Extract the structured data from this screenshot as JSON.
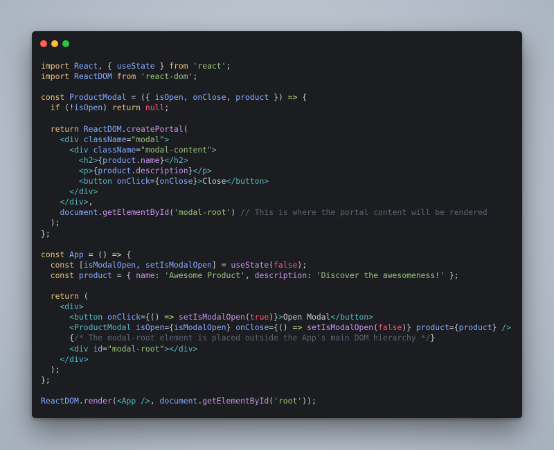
{
  "window": {
    "controls": [
      {
        "name": "close",
        "color": "#ff5f57"
      },
      {
        "name": "minimize",
        "color": "#febc2e"
      },
      {
        "name": "maximize",
        "color": "#28c840"
      }
    ]
  },
  "code_lines": [
    [
      [
        "kw",
        "import"
      ],
      [
        "pun",
        " "
      ],
      [
        "id",
        "React"
      ],
      [
        "pun",
        ", { "
      ],
      [
        "id",
        "useState"
      ],
      [
        "pun",
        " } "
      ],
      [
        "kw",
        "from"
      ],
      [
        "pun",
        " "
      ],
      [
        "str",
        "'react'"
      ],
      [
        "pun",
        ";"
      ]
    ],
    [
      [
        "kw",
        "import"
      ],
      [
        "pun",
        " "
      ],
      [
        "id",
        "ReactDOM"
      ],
      [
        "pun",
        " "
      ],
      [
        "kw",
        "from"
      ],
      [
        "pun",
        " "
      ],
      [
        "str",
        "'react-dom'"
      ],
      [
        "pun",
        ";"
      ]
    ],
    [],
    [
      [
        "kw",
        "const"
      ],
      [
        "pun",
        " "
      ],
      [
        "id",
        "ProductModal"
      ],
      [
        "pun",
        " = ({ "
      ],
      [
        "id",
        "isOpen"
      ],
      [
        "pun",
        ", "
      ],
      [
        "id",
        "onClose"
      ],
      [
        "pun",
        ", "
      ],
      [
        "id",
        "product"
      ],
      [
        "pun",
        " }) "
      ],
      [
        "op",
        "=>"
      ],
      [
        "pun",
        " {"
      ]
    ],
    [
      [
        "pun",
        "  "
      ],
      [
        "kw",
        "if"
      ],
      [
        "pun",
        " (!"
      ],
      [
        "id",
        "isOpen"
      ],
      [
        "pun",
        ") "
      ],
      [
        "kw",
        "return"
      ],
      [
        "pun",
        " "
      ],
      [
        "lit",
        "null"
      ],
      [
        "pun",
        ";"
      ]
    ],
    [],
    [
      [
        "pun",
        "  "
      ],
      [
        "kw",
        "return"
      ],
      [
        "pun",
        " "
      ],
      [
        "id",
        "ReactDOM"
      ],
      [
        "pun",
        "."
      ],
      [
        "fn",
        "createPortal"
      ],
      [
        "pun",
        "("
      ]
    ],
    [
      [
        "pun",
        "    "
      ],
      [
        "tag",
        "<div"
      ],
      [
        "pun",
        " "
      ],
      [
        "attr",
        "className"
      ],
      [
        "pun",
        "="
      ],
      [
        "str",
        "\"modal\""
      ],
      [
        "tag",
        ">"
      ]
    ],
    [
      [
        "pun",
        "      "
      ],
      [
        "tag",
        "<div"
      ],
      [
        "pun",
        " "
      ],
      [
        "attr",
        "className"
      ],
      [
        "pun",
        "="
      ],
      [
        "str",
        "\"modal-content\""
      ],
      [
        "tag",
        ">"
      ]
    ],
    [
      [
        "pun",
        "        "
      ],
      [
        "tag",
        "<h2>"
      ],
      [
        "pun",
        "{"
      ],
      [
        "id",
        "product"
      ],
      [
        "pun",
        "."
      ],
      [
        "prop",
        "name"
      ],
      [
        "pun",
        "}"
      ],
      [
        "tag",
        "</h2>"
      ]
    ],
    [
      [
        "pun",
        "        "
      ],
      [
        "tag",
        "<p>"
      ],
      [
        "pun",
        "{"
      ],
      [
        "id",
        "product"
      ],
      [
        "pun",
        "."
      ],
      [
        "prop",
        "description"
      ],
      [
        "pun",
        "}"
      ],
      [
        "tag",
        "</p>"
      ]
    ],
    [
      [
        "pun",
        "        "
      ],
      [
        "tag",
        "<button"
      ],
      [
        "pun",
        " "
      ],
      [
        "attr",
        "onClick"
      ],
      [
        "pun",
        "={"
      ],
      [
        "id",
        "onClose"
      ],
      [
        "pun",
        "}"
      ],
      [
        "tag",
        ">"
      ],
      [
        "pun",
        "Close"
      ],
      [
        "tag",
        "</button>"
      ]
    ],
    [
      [
        "pun",
        "      "
      ],
      [
        "tag",
        "</div>"
      ]
    ],
    [
      [
        "pun",
        "    "
      ],
      [
        "tag",
        "</div>"
      ],
      [
        "pun",
        ","
      ]
    ],
    [
      [
        "pun",
        "    "
      ],
      [
        "id",
        "document"
      ],
      [
        "pun",
        "."
      ],
      [
        "fn",
        "getElementById"
      ],
      [
        "pun",
        "("
      ],
      [
        "str",
        "'modal-root'"
      ],
      [
        "pun",
        ") "
      ],
      [
        "cm",
        "// This is where the portal content will be rendered"
      ]
    ],
    [
      [
        "pun",
        "  );"
      ]
    ],
    [
      [
        "pun",
        "};"
      ]
    ],
    [],
    [
      [
        "kw",
        "const"
      ],
      [
        "pun",
        " "
      ],
      [
        "id",
        "App"
      ],
      [
        "pun",
        " = () "
      ],
      [
        "op",
        "=>"
      ],
      [
        "pun",
        " {"
      ]
    ],
    [
      [
        "pun",
        "  "
      ],
      [
        "kw",
        "const"
      ],
      [
        "pun",
        " ["
      ],
      [
        "id",
        "isModalOpen"
      ],
      [
        "pun",
        ", "
      ],
      [
        "id",
        "setIsModalOpen"
      ],
      [
        "pun",
        "] = "
      ],
      [
        "fn",
        "useState"
      ],
      [
        "pun",
        "("
      ],
      [
        "lit",
        "false"
      ],
      [
        "pun",
        ");"
      ]
    ],
    [
      [
        "pun",
        "  "
      ],
      [
        "kw",
        "const"
      ],
      [
        "pun",
        " "
      ],
      [
        "id",
        "product"
      ],
      [
        "pun",
        " = { "
      ],
      [
        "prop",
        "name"
      ],
      [
        "pun",
        ": "
      ],
      [
        "str",
        "'Awesome Product'"
      ],
      [
        "pun",
        ", "
      ],
      [
        "prop",
        "description"
      ],
      [
        "pun",
        ": "
      ],
      [
        "str",
        "'Discover the awesomeness!'"
      ],
      [
        "pun",
        " };"
      ]
    ],
    [],
    [
      [
        "pun",
        "  "
      ],
      [
        "kw",
        "return"
      ],
      [
        "pun",
        " ("
      ]
    ],
    [
      [
        "pun",
        "    "
      ],
      [
        "tag",
        "<div>"
      ]
    ],
    [
      [
        "pun",
        "      "
      ],
      [
        "tag",
        "<button"
      ],
      [
        "pun",
        " "
      ],
      [
        "attr",
        "onClick"
      ],
      [
        "pun",
        "={() "
      ],
      [
        "op",
        "=>"
      ],
      [
        "pun",
        " "
      ],
      [
        "fn",
        "setIsModalOpen"
      ],
      [
        "pun",
        "("
      ],
      [
        "lit",
        "true"
      ],
      [
        "pun",
        ")}"
      ],
      [
        "tag",
        ">"
      ],
      [
        "pun",
        "Open Modal"
      ],
      [
        "tag",
        "</button>"
      ]
    ],
    [
      [
        "pun",
        "      "
      ],
      [
        "tag",
        "<ProductModal"
      ],
      [
        "pun",
        " "
      ],
      [
        "attr",
        "isOpen"
      ],
      [
        "pun",
        "={"
      ],
      [
        "id",
        "isModalOpen"
      ],
      [
        "pun",
        "} "
      ],
      [
        "attr",
        "onClose"
      ],
      [
        "pun",
        "={() "
      ],
      [
        "op",
        "=>"
      ],
      [
        "pun",
        " "
      ],
      [
        "fn",
        "setIsModalOpen"
      ],
      [
        "pun",
        "("
      ],
      [
        "lit",
        "false"
      ],
      [
        "pun",
        ")} "
      ],
      [
        "attr",
        "product"
      ],
      [
        "pun",
        "={"
      ],
      [
        "id",
        "product"
      ],
      [
        "pun",
        "} "
      ],
      [
        "tag",
        "/>"
      ]
    ],
    [
      [
        "pun",
        "      {"
      ],
      [
        "cm",
        "/* The modal-root element is placed outside the App's main DOM hierarchy */"
      ],
      [
        "pun",
        "}"
      ]
    ],
    [
      [
        "pun",
        "      "
      ],
      [
        "tag",
        "<div"
      ],
      [
        "pun",
        " "
      ],
      [
        "attr",
        "id"
      ],
      [
        "pun",
        "="
      ],
      [
        "str",
        "\"modal-root\""
      ],
      [
        "tag",
        "></div>"
      ]
    ],
    [
      [
        "pun",
        "    "
      ],
      [
        "tag",
        "</div>"
      ]
    ],
    [
      [
        "pun",
        "  );"
      ]
    ],
    [
      [
        "pun",
        "};"
      ]
    ],
    [],
    [
      [
        "id",
        "ReactDOM"
      ],
      [
        "pun",
        "."
      ],
      [
        "fn",
        "render"
      ],
      [
        "pun",
        "("
      ],
      [
        "tag",
        "<App />"
      ],
      [
        "pun",
        ", "
      ],
      [
        "id",
        "document"
      ],
      [
        "pun",
        "."
      ],
      [
        "fn",
        "getElementById"
      ],
      [
        "pun",
        "("
      ],
      [
        "str",
        "'root'"
      ],
      [
        "pun",
        "));"
      ]
    ]
  ]
}
